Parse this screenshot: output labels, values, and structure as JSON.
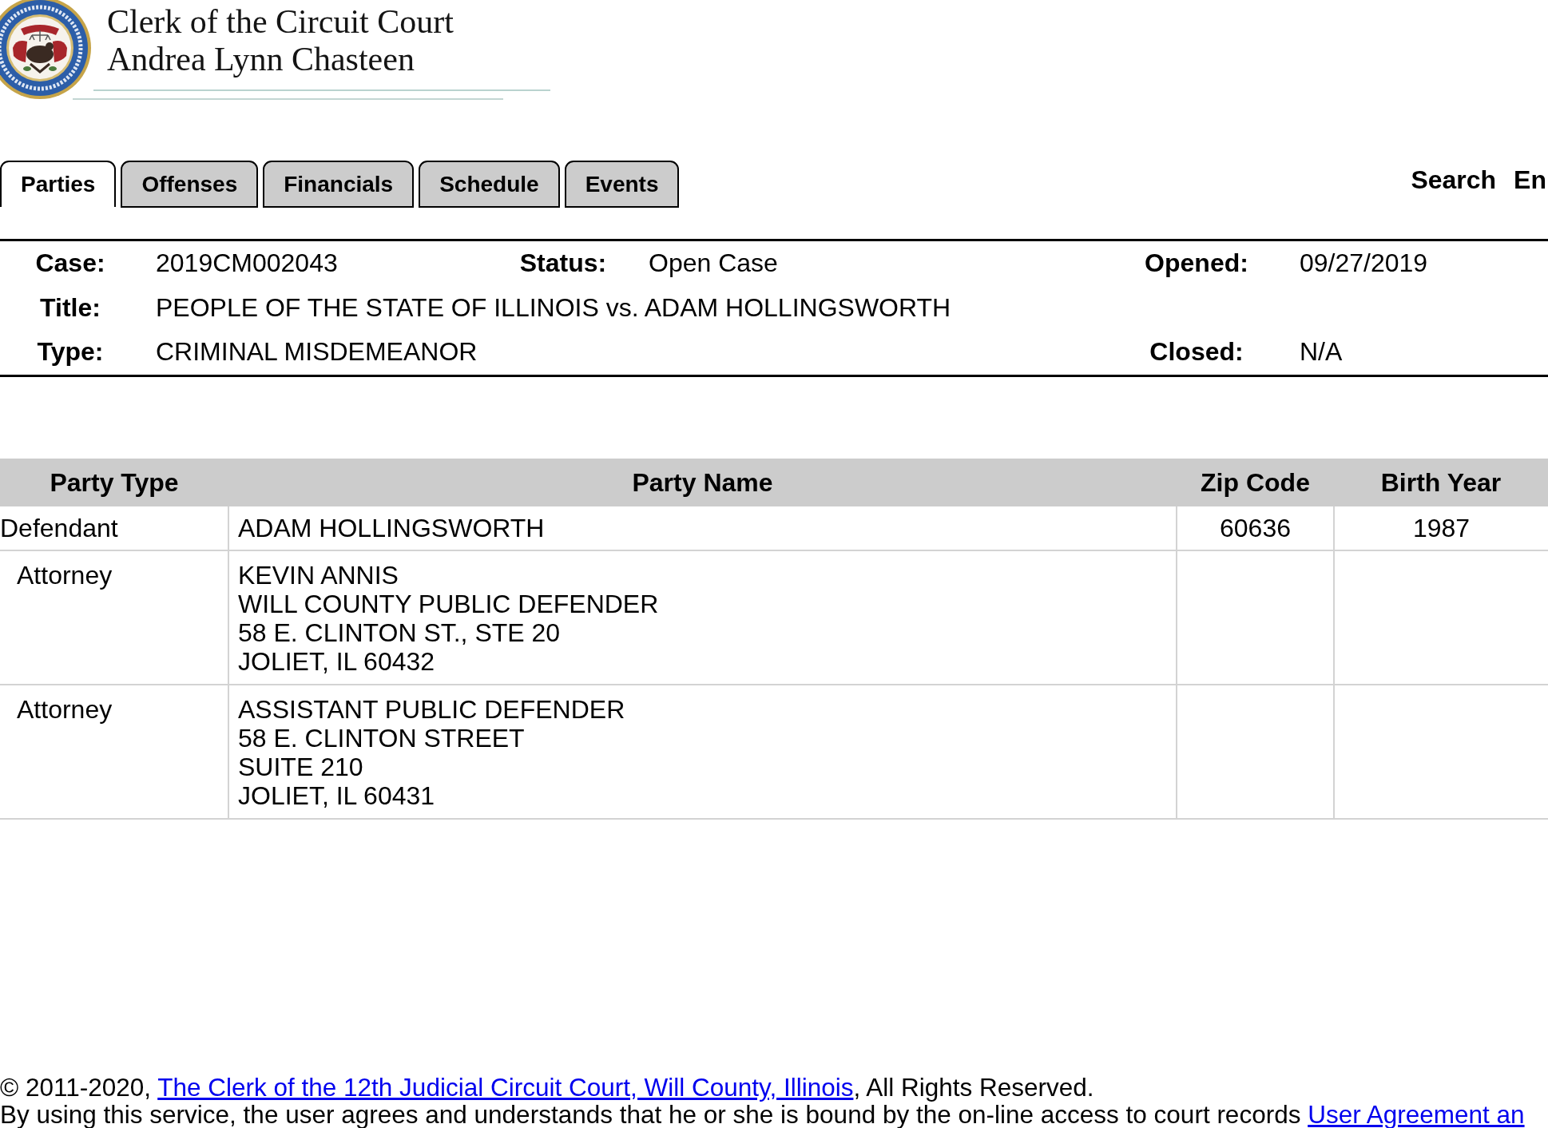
{
  "header": {
    "title": "Clerk of the Circuit Court",
    "subtitle": "Andrea Lynn Chasteen"
  },
  "tabs": [
    {
      "label": "Parties",
      "selected": true
    },
    {
      "label": "Offenses",
      "selected": false
    },
    {
      "label": "Financials",
      "selected": false
    },
    {
      "label": "Schedule",
      "selected": false
    },
    {
      "label": "Events",
      "selected": false
    }
  ],
  "nav_links": [
    "Search",
    "En"
  ],
  "case_summary": {
    "rows": [
      [
        {
          "label": "Case:",
          "value": "2019CM002043"
        },
        {
          "label": "Status:",
          "value": "Open Case"
        },
        {
          "label": "Opened:",
          "value": "09/27/2019"
        }
      ],
      [
        {
          "label": "Title:",
          "value": "PEOPLE OF THE STATE OF ILLINOIS vs. ADAM HOLLINGSWORTH"
        }
      ],
      [
        {
          "label": "Type:",
          "value": "CRIMINAL MISDEMEANOR"
        },
        null,
        {
          "label": "Closed:",
          "value": "N/A"
        }
      ]
    ]
  },
  "parties_table": {
    "columns": [
      "Party Type",
      "Party Name",
      "Zip Code",
      "Birth Year"
    ],
    "rows": [
      {
        "party_type": "Defendant",
        "party_name": [
          "ADAM HOLLINGSWORTH"
        ],
        "zip_code": "60636",
        "birth_year": "1987",
        "children": [
          {
            "party_type": "Attorney",
            "party_name": [
              "KEVIN ANNIS",
              "WILL COUNTY PUBLIC DEFENDER",
              "58 E. CLINTON ST., STE 20",
              "JOLIET, IL 60432"
            ]
          },
          {
            "party_type": "Attorney",
            "party_name": [
              "ASSISTANT PUBLIC DEFENDER",
              "58 E. CLINTON STREET",
              "SUITE 210",
              "JOLIET, IL 60431"
            ]
          }
        ]
      }
    ]
  },
  "footer": {
    "lines": [
      {
        "before": "© 2011-2020, ",
        "link": "The Clerk of the 12th Judicial Circuit Court, Will County, Illinois",
        "after": ", All Rights Reserved."
      },
      {
        "before": "By using this service, the user agrees and understands that he or she is bound by the on-line access to court records ",
        "link": "User Agreement an"
      }
    ]
  }
}
